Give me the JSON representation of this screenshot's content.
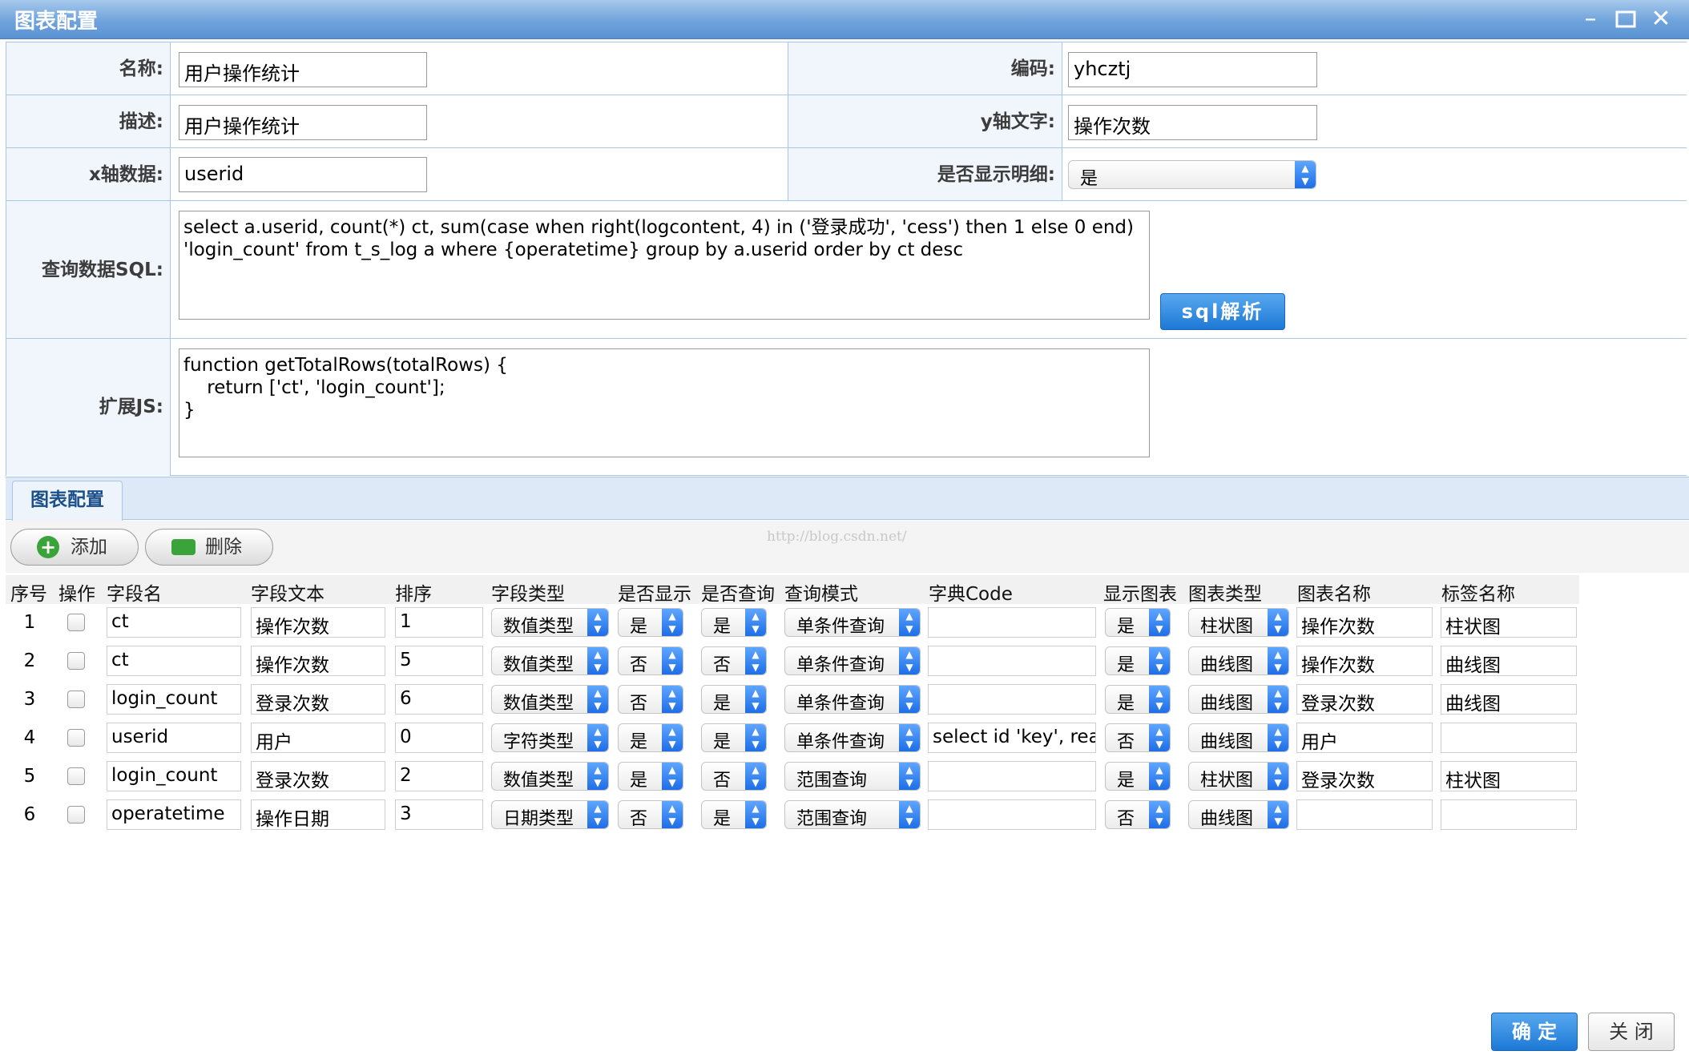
{
  "window": {
    "title": "图表配置"
  },
  "form": {
    "name_label": "名称:",
    "name_value": "用户操作统计",
    "code_label": "编码:",
    "code_value": "yhcztj",
    "desc_label": "描述:",
    "desc_value": "用户操作统计",
    "ytext_label": "y轴文字:",
    "ytext_value": "操作次数",
    "xdata_label": "x轴数据:",
    "xdata_value": "userid",
    "detail_label": "是否显示明细:",
    "detail_value": "是",
    "sql_label": "查询数据SQL:",
    "sql_value": "select a.userid, count(*) ct, sum(case when right(logcontent, 4) in ('登录成功', 'cess') then 1 else 0 end)\n'login_count' from t_s_log a where {operatetime} group by a.userid order by ct desc",
    "sql_parse_button": "sql解析",
    "js_label": "扩展JS:",
    "js_value": "function getTotalRows(totalRows) {\n    return ['ct', 'login_count'];\n}"
  },
  "tab": {
    "label": "图表配置"
  },
  "toolbar": {
    "add_label": "添加",
    "delete_label": "删除",
    "watermark": "http://blog.csdn.net/"
  },
  "grid": {
    "headers": [
      "序号",
      "操作",
      "字段名",
      "字段文本",
      "排序",
      "字段类型",
      "是否显示",
      "是否查询",
      "查询模式",
      "字典Code",
      "显示图表",
      "图表类型",
      "图表名称",
      "标签名称"
    ],
    "rows": [
      {
        "no": "1",
        "field": "ct",
        "text": "操作次数",
        "order": "1",
        "type": "数值类型",
        "show": "是",
        "query": "是",
        "mode": "单条件查询",
        "dict": "",
        "chart": "是",
        "chart_type": "柱状图",
        "chart_name": "操作次数",
        "tag": "柱状图"
      },
      {
        "no": "2",
        "field": "ct",
        "text": "操作次数",
        "order": "5",
        "type": "数值类型",
        "show": "否",
        "query": "否",
        "mode": "单条件查询",
        "dict": "",
        "chart": "是",
        "chart_type": "曲线图",
        "chart_name": "操作次数",
        "tag": "曲线图"
      },
      {
        "no": "3",
        "field": "login_count",
        "text": "登录次数",
        "order": "6",
        "type": "数值类型",
        "show": "否",
        "query": "是",
        "mode": "单条件查询",
        "dict": "",
        "chart": "是",
        "chart_type": "曲线图",
        "chart_name": "登录次数",
        "tag": "曲线图"
      },
      {
        "no": "4",
        "field": "userid",
        "text": "用户",
        "order": "0",
        "type": "字符类型",
        "show": "是",
        "query": "是",
        "mode": "单条件查询",
        "dict": "select id 'key', realı",
        "chart": "否",
        "chart_type": "曲线图",
        "chart_name": "用户",
        "tag": ""
      },
      {
        "no": "5",
        "field": "login_count",
        "text": "登录次数",
        "order": "2",
        "type": "数值类型",
        "show": "是",
        "query": "否",
        "mode": "范围查询",
        "dict": "",
        "chart": "是",
        "chart_type": "柱状图",
        "chart_name": "登录次数",
        "tag": "柱状图"
      },
      {
        "no": "6",
        "field": "operatetime",
        "text": "操作日期",
        "order": "3",
        "type": "日期类型",
        "show": "否",
        "query": "是",
        "mode": "范围查询",
        "dict": "",
        "chart": "否",
        "chart_type": "曲线图",
        "chart_name": "",
        "tag": ""
      }
    ]
  },
  "footer": {
    "ok_label": "确 定",
    "close_label": "关 闭"
  },
  "colors": {
    "titlebar": "#6fa3db",
    "accent": "#1d79d6",
    "border": "#a9c6e6"
  }
}
